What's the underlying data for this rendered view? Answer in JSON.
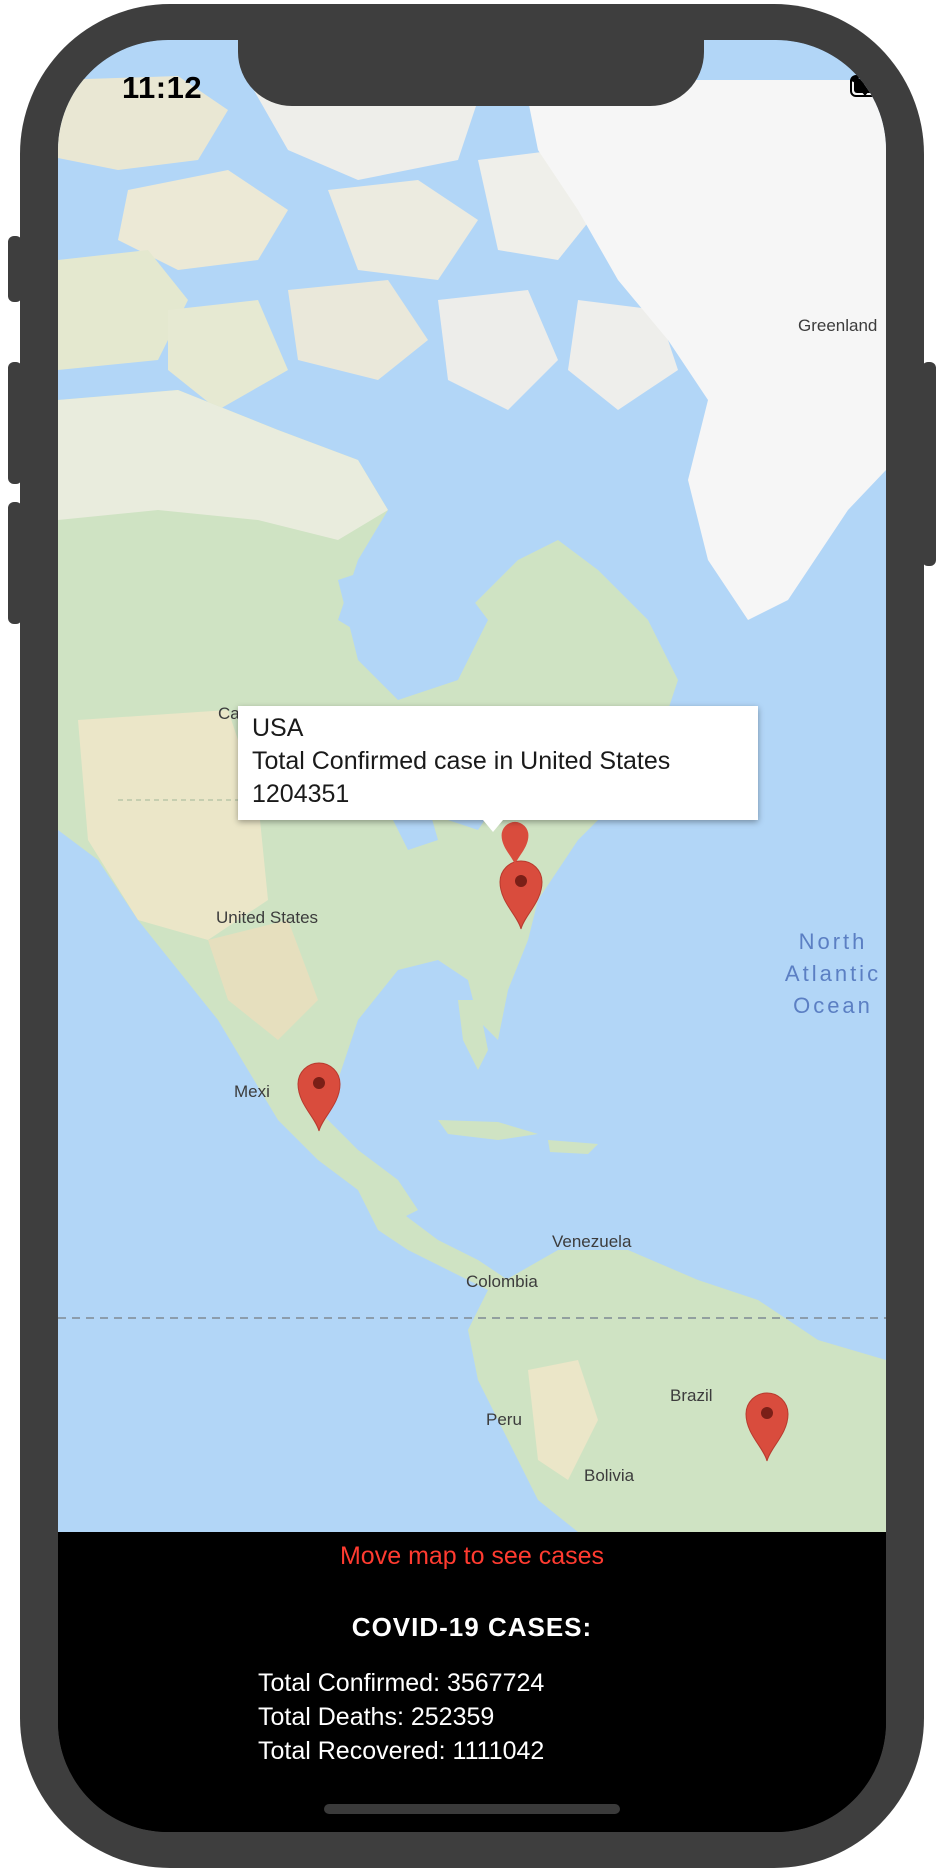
{
  "status_bar": {
    "time": "11:12"
  },
  "map": {
    "labels": {
      "greenland": "Greenland",
      "canada": "Ca",
      "united_states": "United States",
      "mexico": "Mexi",
      "venezuela": "Venezuela",
      "colombia": "Colombia",
      "brazil": "Brazil",
      "peru": "Peru",
      "bolivia": "Bolivia"
    },
    "ocean_label": [
      "North",
      "Atlantic",
      "Ocean"
    ],
    "callout": {
      "title": "USA",
      "line1": "Total Confirmed case in United States",
      "line2": "1204351"
    },
    "marker_icon": "map-pin-icon",
    "marker_color": "#d94c3d"
  },
  "panel": {
    "hint": "Move map to see cases",
    "title": "COVID-19 CASES:",
    "confirmed": "Total Confirmed: 3567724",
    "deaths": "Total Deaths: 252359",
    "recovered": "Total Recovered: 1111042"
  },
  "colors": {
    "ocean": "#b2d6f7",
    "land": "#cfe3c3",
    "ice": "#f5f5f5",
    "hint": "#ff3b30",
    "device": "#3e3e3e"
  }
}
